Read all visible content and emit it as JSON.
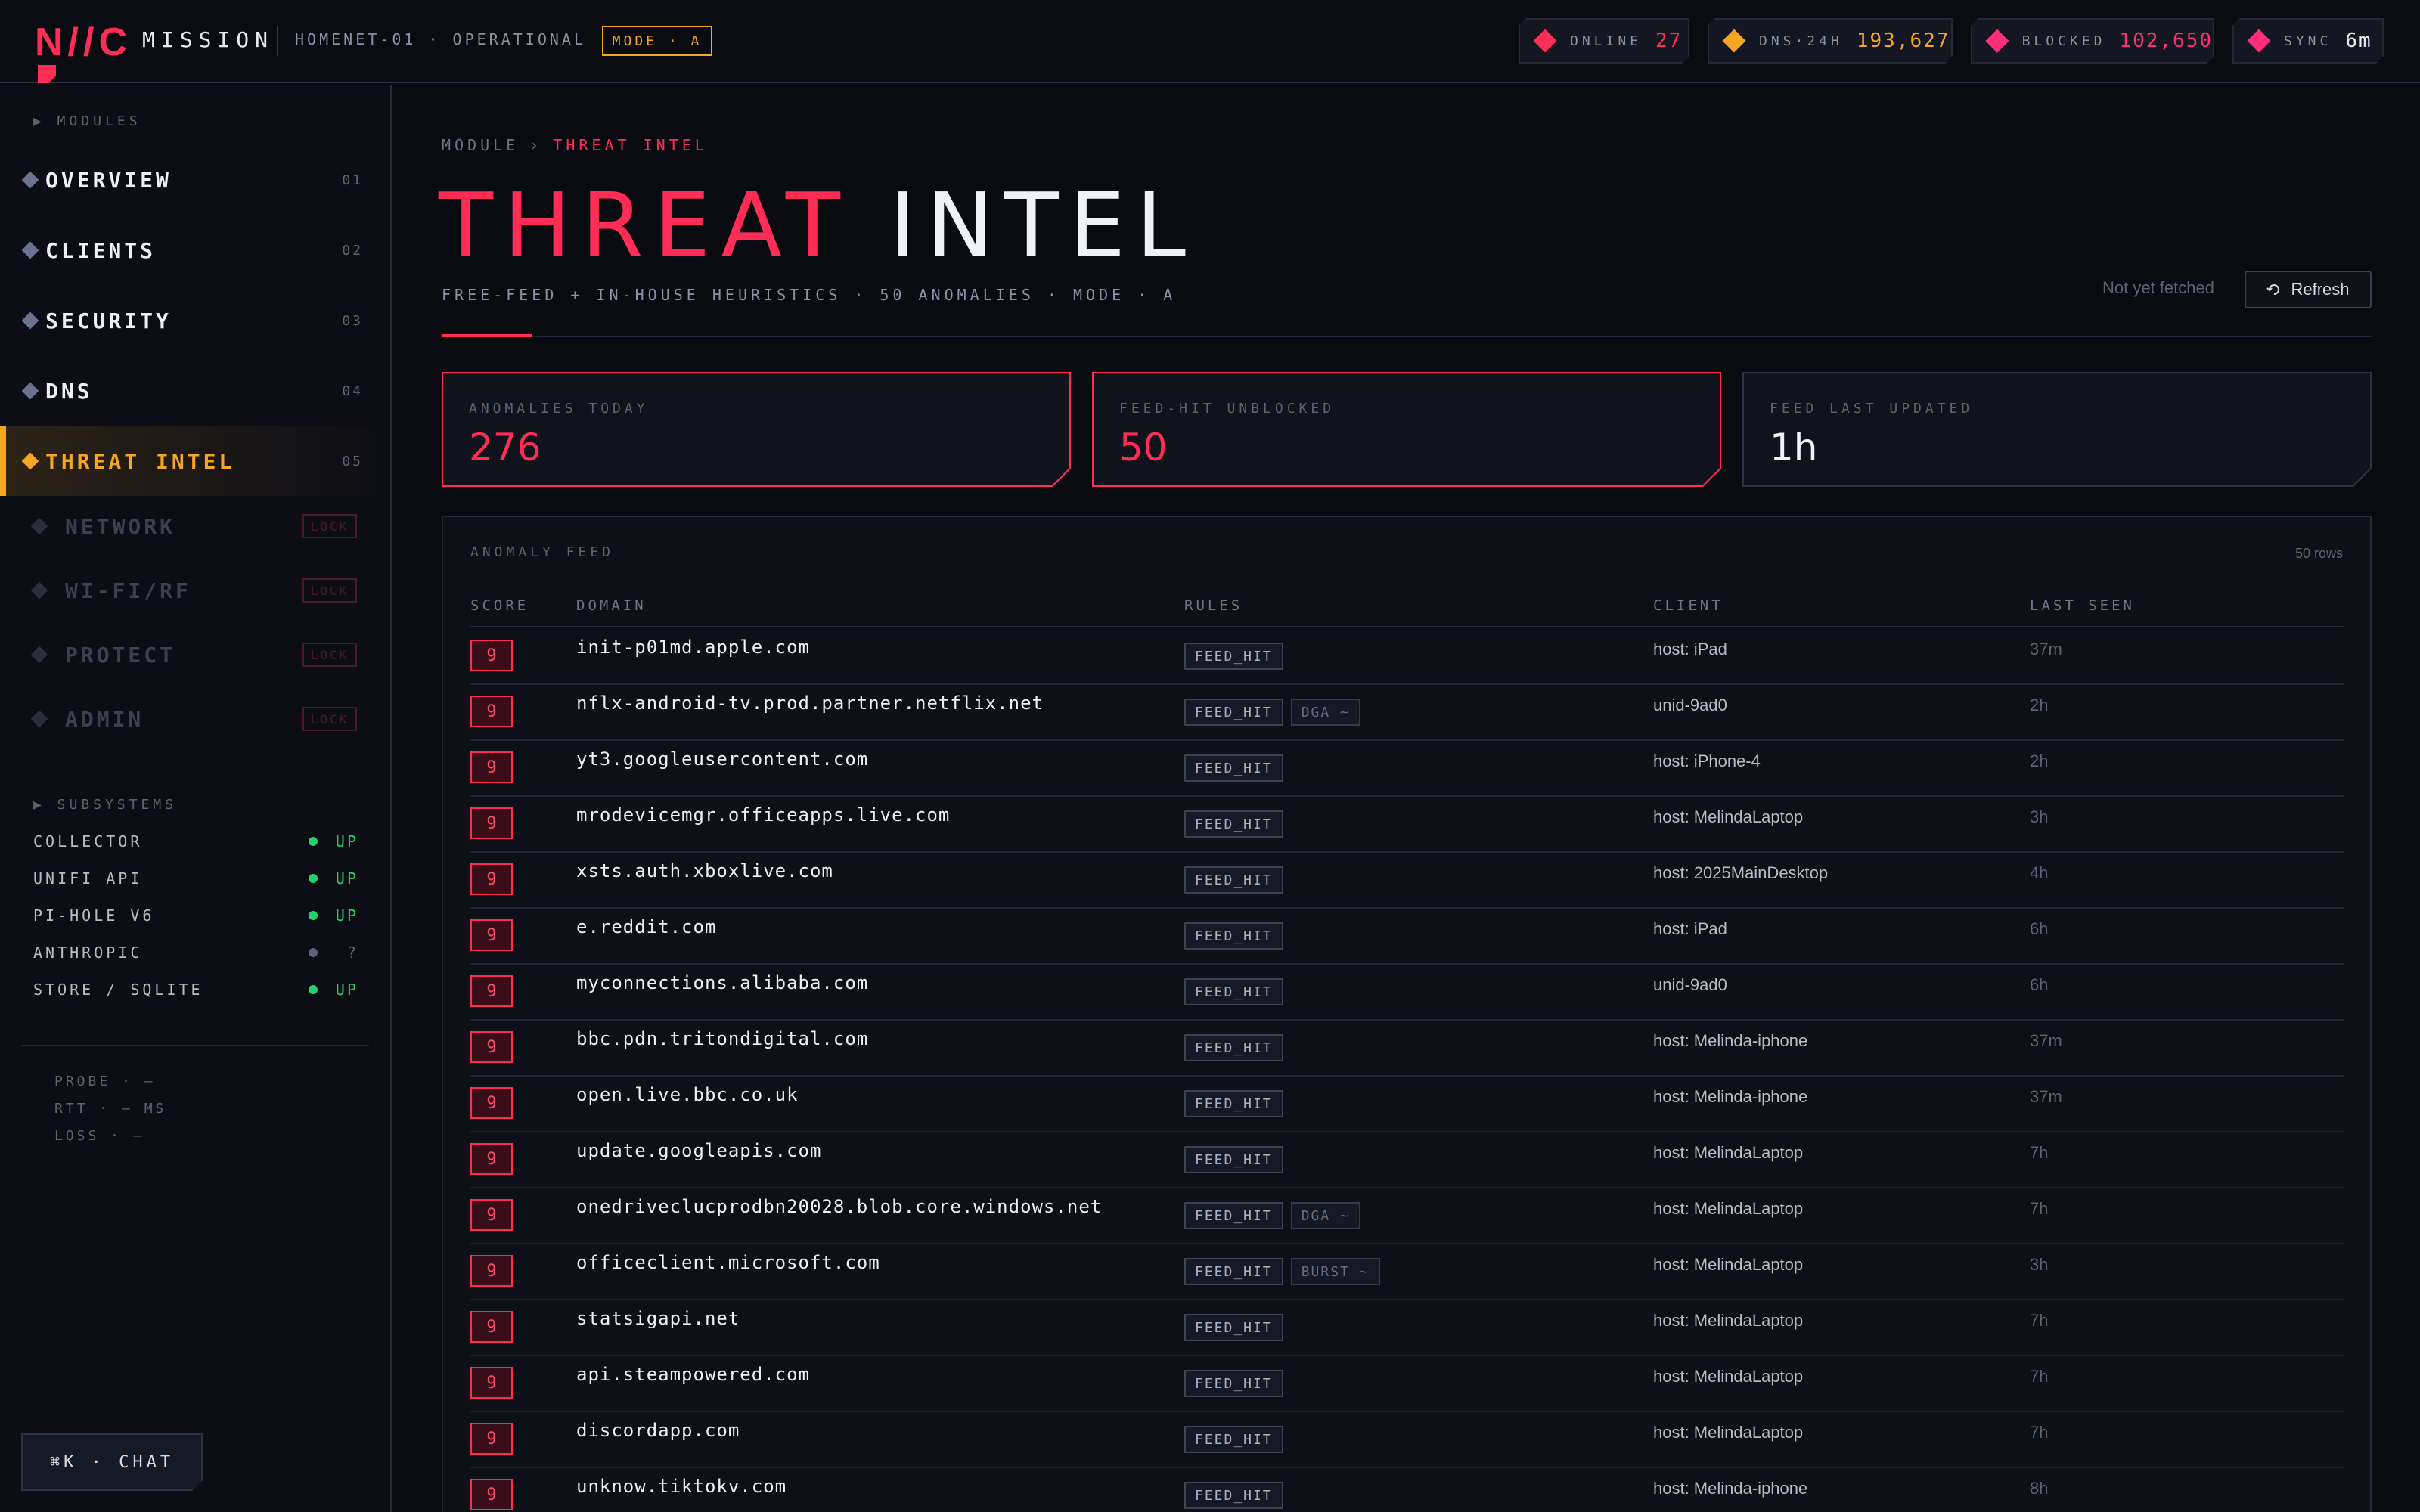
{
  "header": {
    "logo": "N//C",
    "brand": "MISSION",
    "node": "HOMENET-01 · OPERATIONAL",
    "mode": "MODE · A",
    "stats": [
      {
        "label": "ONLINE",
        "value": "27",
        "color": "#ff2d55",
        "icon": "diamond-red-icon"
      },
      {
        "label": "DNS·24H",
        "value": "193,627",
        "color": "#f5a623",
        "icon": "diamond-amber-icon"
      },
      {
        "label": "BLOCKED",
        "value": "102,650",
        "color": "#ff2d7a",
        "icon": "diamond-pink-icon"
      },
      {
        "label": "SYNC",
        "value": "6m",
        "color": "#e8eaf2",
        "icon": "diamond-pink-icon"
      }
    ]
  },
  "sidebar": {
    "modules_label": "▶ MODULES",
    "items": [
      {
        "label": "OVERVIEW",
        "num": "01"
      },
      {
        "label": "CLIENTS",
        "num": "02"
      },
      {
        "label": "SECURITY",
        "num": "03"
      },
      {
        "label": "DNS",
        "num": "04"
      },
      {
        "label": "THREAT INTEL",
        "num": "05"
      }
    ],
    "locked_items": [
      {
        "label": "NETWORK",
        "badge": "LOCK"
      },
      {
        "label": "WI-FI/RF",
        "badge": "LOCK"
      },
      {
        "label": "PROTECT",
        "badge": "LOCK"
      },
      {
        "label": "ADMIN",
        "badge": "LOCK"
      }
    ],
    "subsystems_label": "▶ SUBSYSTEMS",
    "subsystems": [
      {
        "name": "COLLECTOR",
        "status": "UP",
        "color": "#22d36b"
      },
      {
        "name": "UNIFI API",
        "status": "UP",
        "color": "#22d36b"
      },
      {
        "name": "PI-HOLE V6",
        "status": "UP",
        "color": "#22d36b"
      },
      {
        "name": "ANTHROPIC",
        "status": "?",
        "color": "#5c6278"
      },
      {
        "name": "STORE / SQLITE",
        "status": "UP",
        "color": "#22d36b"
      }
    ],
    "probe": [
      "PROBE · —",
      "RTT · — MS",
      "LOSS · —"
    ],
    "chat": "⌘K · CHAT"
  },
  "main": {
    "crumb_root": "MODULE",
    "crumb_sep": "›",
    "crumb_current": "THREAT INTEL",
    "title_a": "THREAT",
    "title_b": "INTEL",
    "subtitle": "FREE-FEED + IN-HOUSE HEURISTICS · 50 ANOMALIES · MODE · A",
    "not_fetched": "Not yet fetched",
    "refresh": "Refresh",
    "kpis": [
      {
        "label": "ANOMALIES TODAY",
        "value": "276",
        "color": "#ff2d55",
        "border": "#ff2d55"
      },
      {
        "label": "FEED-HIT UNBLOCKED",
        "value": "50",
        "color": "#ff2d55",
        "border": "#ff2d55"
      },
      {
        "label": "FEED LAST UPDATED",
        "value": "1h",
        "color": "#f0f2f8",
        "border": "#2c3145"
      }
    ],
    "feed": {
      "label": "ANOMALY FEED",
      "count": "50 rows",
      "columns": [
        "SCORE",
        "DOMAIN",
        "RULES",
        "CLIENT",
        "LAST SEEN"
      ],
      "rows": [
        {
          "score": "9",
          "domain": "init-p01md.apple.com",
          "rules": [
            "FEED_HIT"
          ],
          "client": "host: iPad",
          "seen": "37m"
        },
        {
          "score": "9",
          "domain": "nflx-android-tv.prod.partner.netflix.net",
          "rules": [
            "FEED_HIT",
            "DGA ~"
          ],
          "client": "unid-9ad0",
          "seen": "2h"
        },
        {
          "score": "9",
          "domain": "yt3.googleusercontent.com",
          "rules": [
            "FEED_HIT"
          ],
          "client": "host: iPhone-4",
          "seen": "2h"
        },
        {
          "score": "9",
          "domain": "mrodevicemgr.officeapps.live.com",
          "rules": [
            "FEED_HIT"
          ],
          "client": "host: MelindaLaptop",
          "seen": "3h"
        },
        {
          "score": "9",
          "domain": "xsts.auth.xboxlive.com",
          "rules": [
            "FEED_HIT"
          ],
          "client": "host: 2025MainDesktop",
          "seen": "4h"
        },
        {
          "score": "9",
          "domain": "e.reddit.com",
          "rules": [
            "FEED_HIT"
          ],
          "client": "host: iPad",
          "seen": "6h"
        },
        {
          "score": "9",
          "domain": "myconnections.alibaba.com",
          "rules": [
            "FEED_HIT"
          ],
          "client": "unid-9ad0",
          "seen": "6h"
        },
        {
          "score": "9",
          "domain": "bbc.pdn.tritondigital.com",
          "rules": [
            "FEED_HIT"
          ],
          "client": "host: Melinda-iphone",
          "seen": "37m"
        },
        {
          "score": "9",
          "domain": "open.live.bbc.co.uk",
          "rules": [
            "FEED_HIT"
          ],
          "client": "host: Melinda-iphone",
          "seen": "37m"
        },
        {
          "score": "9",
          "domain": "update.googleapis.com",
          "rules": [
            "FEED_HIT"
          ],
          "client": "host: MelindaLaptop",
          "seen": "7h"
        },
        {
          "score": "9",
          "domain": "onedriveclucprodbn20028.blob.core.windows.net",
          "rules": [
            "FEED_HIT",
            "DGA ~"
          ],
          "client": "host: MelindaLaptop",
          "seen": "7h"
        },
        {
          "score": "9",
          "domain": "officeclient.microsoft.com",
          "rules": [
            "FEED_HIT",
            "BURST ~"
          ],
          "client": "host: MelindaLaptop",
          "seen": "3h"
        },
        {
          "score": "9",
          "domain": "statsigapi.net",
          "rules": [
            "FEED_HIT"
          ],
          "client": "host: MelindaLaptop",
          "seen": "7h"
        },
        {
          "score": "9",
          "domain": "api.steampowered.com",
          "rules": [
            "FEED_HIT"
          ],
          "client": "host: MelindaLaptop",
          "seen": "7h"
        },
        {
          "score": "9",
          "domain": "discordapp.com",
          "rules": [
            "FEED_HIT"
          ],
          "client": "host: MelindaLaptop",
          "seen": "7h"
        },
        {
          "score": "9",
          "domain": "unknow.tiktokv.com",
          "rules": [
            "FEED_HIT"
          ],
          "client": "host: Melinda-iphone",
          "seen": "8h"
        }
      ]
    }
  }
}
